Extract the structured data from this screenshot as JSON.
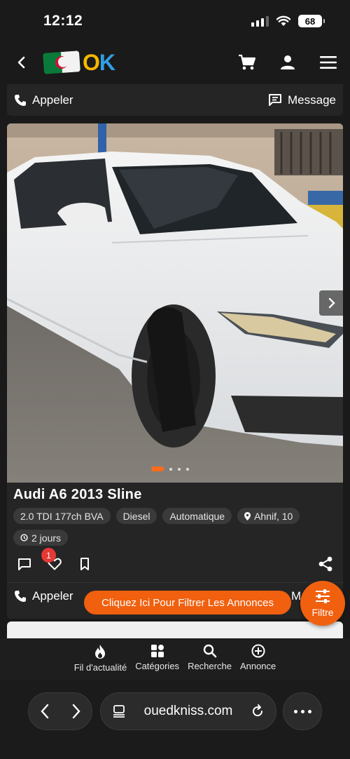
{
  "status": {
    "time": "12:12",
    "battery": "68"
  },
  "header": {
    "logo_letter_o": "O",
    "logo_letter_k": "K",
    "icons": [
      "back-icon",
      "cart-icon",
      "user-icon",
      "menu-icon"
    ]
  },
  "call_bar": {
    "call_label": "Appeler",
    "message_label": "Message"
  },
  "listing": {
    "title": "Audi A6 2013 Sline",
    "chips": [
      {
        "label": "2.0 TDI 177ch BVA"
      },
      {
        "label": "Diesel"
      },
      {
        "label": "Automatique"
      },
      {
        "label": "Ahnif, 10"
      },
      {
        "label": "2 jours"
      }
    ],
    "likes_badge": "1",
    "call_label": "Appeler",
    "message_label": "M",
    "photo_index": 1,
    "photo_count": 4
  },
  "filter": {
    "banner": "Cliquez Ici Pour Filtrer Les Annonces",
    "button": "Filtre"
  },
  "bottom_nav": [
    {
      "label": "Fil d'actualité",
      "icon": "fire-icon"
    },
    {
      "label": "Catégories",
      "icon": "grid-icon"
    },
    {
      "label": "Recherche",
      "icon": "search-icon"
    },
    {
      "label": "Annonce",
      "icon": "plus-circle-icon"
    }
  ],
  "browser": {
    "url": "ouedkniss.com"
  },
  "colors": {
    "accent": "#f0600f",
    "background": "#1a1a1a",
    "card": "#252525",
    "badge": "#e53935"
  }
}
